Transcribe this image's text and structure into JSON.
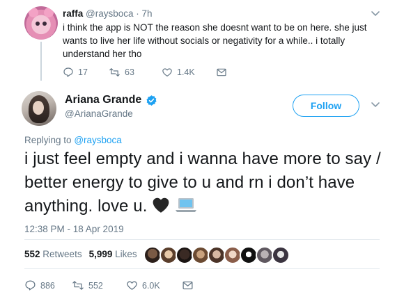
{
  "reply_tweet": {
    "name": "raffa",
    "handle": "@raysboca",
    "separator": "·",
    "time": "7h",
    "text": "i think the app is NOT the reason she doesnt want to be on here. she just wants to live her life without socials or negativity for a while.. i totally understand her tho",
    "actions": {
      "replies": "17",
      "retweets": "63",
      "likes": "1.4K"
    }
  },
  "main_tweet": {
    "name": "Ariana Grande",
    "handle": "@ArianaGrande",
    "follow_label": "Follow",
    "replying_prefix": "Replying to",
    "replying_to": "@raysboca",
    "text": "i just feel empty and i wanna have more to say / better energy to give to u and rn i don’t have anything. love u.",
    "timestamp": "12:38 PM - 18 Apr 2019",
    "retweets_count": "552",
    "retweets_label": "Retweets",
    "likes_count": "5,999",
    "likes_label": "Likes",
    "actions": {
      "replies": "886",
      "retweets": "552",
      "likes": "6.0K"
    }
  },
  "colors": {
    "accent": "#1da1f2",
    "muted": "#657786",
    "text": "#14171a",
    "divider": "#e6ecf0"
  },
  "icons": [
    "chevron-down-icon",
    "reply-icon",
    "retweet-icon",
    "like-icon",
    "message-icon",
    "verified-icon",
    "black-heart-emoji",
    "laptop-emoji"
  ]
}
